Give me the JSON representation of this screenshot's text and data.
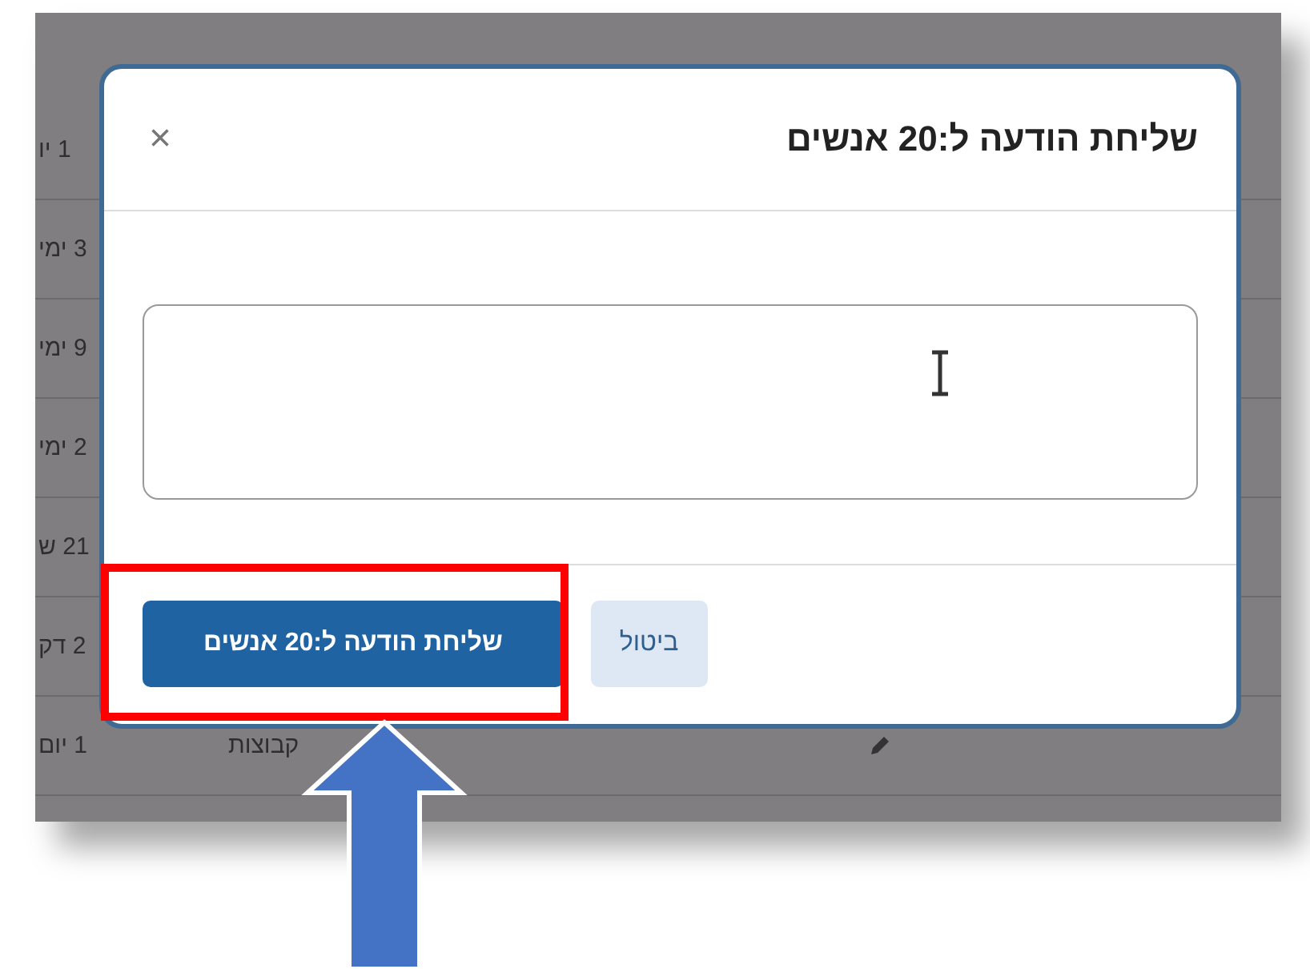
{
  "background_table": {
    "rows": [
      {
        "cell": "1 יו"
      },
      {
        "cell": "3 ימי"
      },
      {
        "cell": "9 ימי"
      },
      {
        "cell": "2 ימי"
      },
      {
        "cell": "21 ש"
      },
      {
        "cell": "2 דק"
      },
      {
        "cell": "1 יום",
        "extra": "קבוצות"
      }
    ]
  },
  "dialog": {
    "title": "שליחת הודעה ל:20 אנשים",
    "close": "×",
    "buttons": [
      {
        "label": "ביטול",
        "kind": "secondary"
      },
      {
        "label": "שליחת הודעה ל:20 אנשים",
        "kind": "primary"
      }
    ]
  }
}
